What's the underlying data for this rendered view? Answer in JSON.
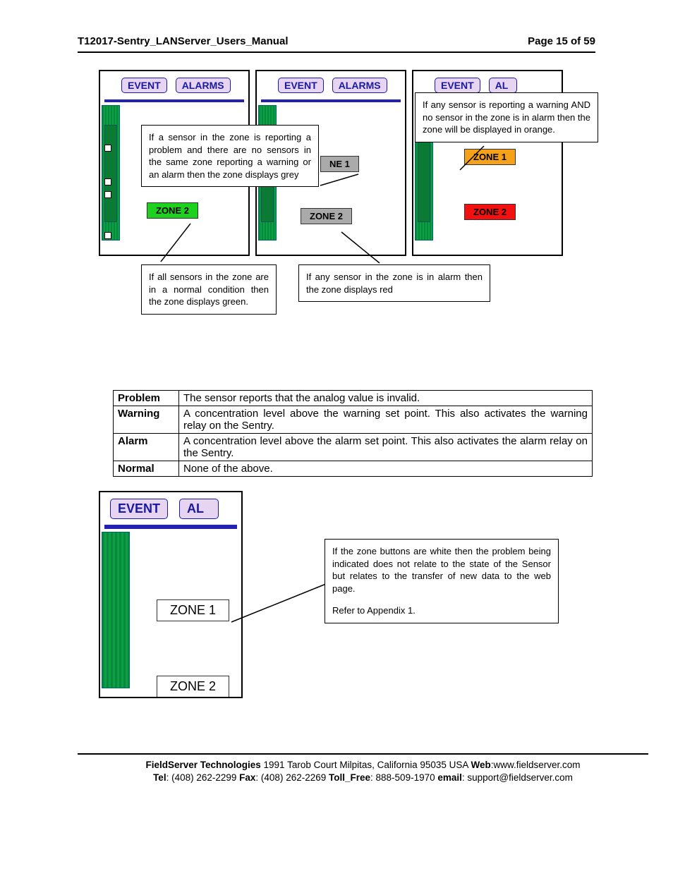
{
  "header": {
    "title": "T12017-Sentry_LANServer_Users_Manual",
    "page": "Page 15 of 59"
  },
  "buttons": {
    "event": "EVENT",
    "alarms": "ALARMS",
    "al_partial": "AL"
  },
  "zones": {
    "ne1_partial": "NE 1",
    "zone1": "ZONE 1",
    "zone2": "ZONE 2"
  },
  "callouts": {
    "grey": "If a sensor in the zone is reporting a problem and there are no sensors in the same zone reporting a warning or an alarm then the zone displays grey",
    "orange": "If any sensor is reporting a warning AND no sensor in the zone is in alarm then the zone will be displayed in orange.",
    "green": "If all sensors in the zone are in a normal condition then the zone displays green.",
    "red": "If any sensor in the zone is in alarm then the zone displays red",
    "white_p1": "If the zone buttons are white then the problem being indicated does not relate to the state of the Sensor but relates to the transfer of new data to the web page.",
    "white_p2": "Refer to Appendix 1."
  },
  "table": {
    "rows": [
      {
        "k": "Problem",
        "v": "The sensor reports that the analog value is invalid."
      },
      {
        "k": "Warning",
        "v": "A concentration level above the warning set point. This also activates the warning relay on the Sentry."
      },
      {
        "k": "Alarm",
        "v": "A concentration level above the alarm set point. This also activates the alarm relay on the Sentry."
      },
      {
        "k": "Normal",
        "v": "None of the above."
      }
    ]
  },
  "footer": {
    "company": "FieldServer Technologies",
    "addr": " 1991 Tarob Court Milpitas, California 95035 USA ",
    "web_l": "Web",
    "web_v": ":www.fieldserver.com",
    "tel_l": "Tel",
    "tel_v": ": (408) 262-2299  ",
    "fax_l": "Fax",
    "fax_v": ": (408) 262-2269  ",
    "tf_l": "Toll_Free",
    "tf_v": ": 888-509-1970  ",
    "em_l": "email",
    "em_v": ": support@fieldserver.com"
  }
}
